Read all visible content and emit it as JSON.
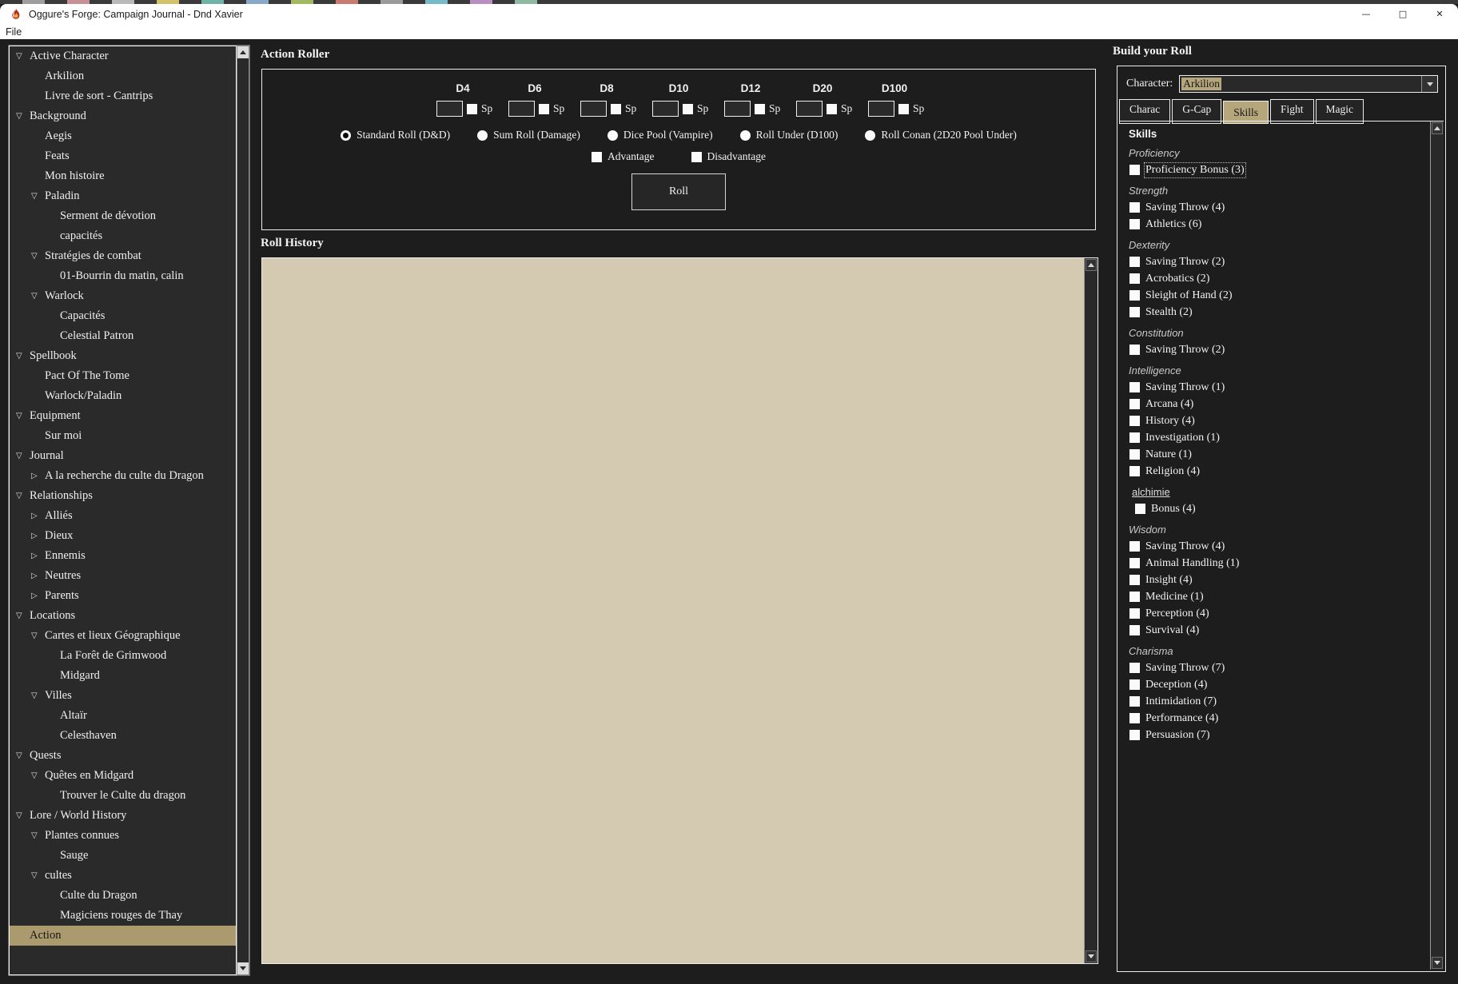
{
  "window": {
    "title": "Oggure's Forge: Campaign Journal - Dnd Xavier",
    "menu": [
      "File"
    ],
    "controls": [
      {
        "name": "minimize",
        "glyph": "—"
      },
      {
        "name": "maximize",
        "glyph": "□"
      },
      {
        "name": "close",
        "glyph": "✕"
      }
    ]
  },
  "background_strip_colors": [
    "#3a3a3c",
    "#9e9e9e",
    "#3a3a3c",
    "#c78f96",
    "#3a3a3c",
    "#b9b9b9",
    "#3a3a3c",
    "#d3c069",
    "#3a3a3c",
    "#6fb3a6",
    "#3a3a3c",
    "#88a7c9",
    "#3a3a3c",
    "#a3b960",
    "#3a3a3c",
    "#c97a70",
    "#3a3a3c",
    "#9b9b9b",
    "#3a3a3c",
    "#76b9c9",
    "#3a3a3c",
    "#b98fc2",
    "#3a3a3c",
    "#8fb9a0",
    "#3a3a3c"
  ],
  "sidebar": {
    "items": [
      {
        "label": "Active Character",
        "level": 0,
        "state": "open"
      },
      {
        "label": "Arkilion",
        "level": 1,
        "state": "leaf"
      },
      {
        "label": "Livre de sort - Cantrips",
        "level": 1,
        "state": "leaf"
      },
      {
        "label": "Background",
        "level": 0,
        "state": "open"
      },
      {
        "label": "Aegis",
        "level": 1,
        "state": "leaf"
      },
      {
        "label": "Feats",
        "level": 1,
        "state": "leaf"
      },
      {
        "label": "Mon histoire",
        "level": 1,
        "state": "leaf"
      },
      {
        "label": "Paladin",
        "level": 1,
        "state": "open"
      },
      {
        "label": "Serment de dévotion",
        "level": 2,
        "state": "leaf"
      },
      {
        "label": "capacités",
        "level": 2,
        "state": "leaf"
      },
      {
        "label": "Stratégies de combat",
        "level": 1,
        "state": "open"
      },
      {
        "label": "01-Bourrin du matin, calin",
        "level": 2,
        "state": "leaf"
      },
      {
        "label": "Warlock",
        "level": 1,
        "state": "open"
      },
      {
        "label": "Capacités",
        "level": 2,
        "state": "leaf"
      },
      {
        "label": "Celestial Patron",
        "level": 2,
        "state": "leaf"
      },
      {
        "label": "Spellbook",
        "level": 0,
        "state": "open"
      },
      {
        "label": "Pact Of The Tome",
        "level": 1,
        "state": "leaf"
      },
      {
        "label": "Warlock/Paladin",
        "level": 1,
        "state": "leaf"
      },
      {
        "label": "Equipment",
        "level": 0,
        "state": "open"
      },
      {
        "label": "Sur moi",
        "level": 1,
        "state": "leaf"
      },
      {
        "label": "Journal",
        "level": 0,
        "state": "open"
      },
      {
        "label": "A la recherche du culte du Dragon",
        "level": 1,
        "state": "closed"
      },
      {
        "label": "Relationships",
        "level": 0,
        "state": "open"
      },
      {
        "label": "Alliés",
        "level": 1,
        "state": "closed"
      },
      {
        "label": "Dieux",
        "level": 1,
        "state": "closed"
      },
      {
        "label": "Ennemis",
        "level": 1,
        "state": "closed"
      },
      {
        "label": "Neutres",
        "level": 1,
        "state": "closed"
      },
      {
        "label": "Parents",
        "level": 1,
        "state": "closed"
      },
      {
        "label": "Locations",
        "level": 0,
        "state": "open"
      },
      {
        "label": "Cartes et lieux Géographique",
        "level": 1,
        "state": "open"
      },
      {
        "label": "La Forêt de Grimwood",
        "level": 2,
        "state": "leaf"
      },
      {
        "label": "Midgard",
        "level": 2,
        "state": "leaf"
      },
      {
        "label": "Villes",
        "level": 1,
        "state": "open"
      },
      {
        "label": "Altaïr",
        "level": 2,
        "state": "leaf"
      },
      {
        "label": "Celesthaven",
        "level": 2,
        "state": "leaf"
      },
      {
        "label": "Quests",
        "level": 0,
        "state": "open"
      },
      {
        "label": "Quêtes en Midgard",
        "level": 1,
        "state": "open"
      },
      {
        "label": "Trouver le Culte du dragon",
        "level": 2,
        "state": "leaf"
      },
      {
        "label": "Lore / World History",
        "level": 0,
        "state": "open"
      },
      {
        "label": "Plantes connues",
        "level": 1,
        "state": "open"
      },
      {
        "label": "Sauge",
        "level": 2,
        "state": "leaf"
      },
      {
        "label": "cultes",
        "level": 1,
        "state": "open"
      },
      {
        "label": "Culte du Dragon",
        "level": 2,
        "state": "leaf"
      },
      {
        "label": "Magiciens rouges de Thay",
        "level": 2,
        "state": "leaf"
      },
      {
        "label": "Action",
        "level": 0,
        "state": "leaf",
        "selected": true
      }
    ]
  },
  "action_roller": {
    "title": "Action Roller",
    "dice": [
      {
        "label": "D4",
        "value": "",
        "sp_label": "Sp",
        "sp_checked": false
      },
      {
        "label": "D6",
        "value": "",
        "sp_label": "Sp",
        "sp_checked": false
      },
      {
        "label": "D8",
        "value": "",
        "sp_label": "Sp",
        "sp_checked": false
      },
      {
        "label": "D10",
        "value": "",
        "sp_label": "Sp",
        "sp_checked": false
      },
      {
        "label": "D12",
        "value": "",
        "sp_label": "Sp",
        "sp_checked": false
      },
      {
        "label": "D20",
        "value": "",
        "sp_label": "Sp",
        "sp_checked": false
      },
      {
        "label": "D100",
        "value": "",
        "sp_label": "Sp",
        "sp_checked": false
      }
    ],
    "roll_modes": [
      {
        "label": "Standard Roll (D&D)",
        "selected": true
      },
      {
        "label": "Sum Roll (Damage)",
        "selected": false
      },
      {
        "label": "Dice Pool (Vampire)",
        "selected": false
      },
      {
        "label": "Roll Under (D100)",
        "selected": false
      },
      {
        "label": "Roll Conan (2D20 Pool Under)",
        "selected": false
      }
    ],
    "modifiers": [
      {
        "label": "Advantage",
        "checked": false
      },
      {
        "label": "Disadvantage",
        "checked": false
      }
    ],
    "roll_button": "Roll"
  },
  "roll_history": {
    "title": "Roll History"
  },
  "build_roll": {
    "title": "Build your Roll",
    "character_label": "Character:",
    "character_value": "Arkilion",
    "tabs": [
      {
        "label": "Charac",
        "active": false
      },
      {
        "label": "G-Cap",
        "active": false
      },
      {
        "label": "Skills",
        "active": true
      },
      {
        "label": "Fight",
        "active": false
      },
      {
        "label": "Magic",
        "active": false
      }
    ],
    "skills": {
      "header": "Skills",
      "focused_item": "Proficiency Bonus (3)",
      "groups": [
        {
          "name": "Proficiency",
          "style": "italic",
          "items": [
            "Proficiency Bonus (3)"
          ]
        },
        {
          "name": "Strength",
          "style": "italic",
          "items": [
            "Saving Throw (4)",
            "Athletics (6)"
          ]
        },
        {
          "name": "Dexterity",
          "style": "italic",
          "items": [
            "Saving Throw (2)",
            "Acrobatics (2)",
            "Sleight of Hand (2)",
            "Stealth (2)"
          ]
        },
        {
          "name": "Constitution",
          "style": "italic",
          "items": [
            "Saving Throw (2)"
          ]
        },
        {
          "name": "Intelligence",
          "style": "italic",
          "items": [
            "Saving Throw (1)",
            "Arcana (4)",
            "History (4)",
            "Investigation (1)",
            "Nature (1)",
            "Religion (4)"
          ]
        },
        {
          "name": "alchimie",
          "style": "underline",
          "items": [
            "Bonus (4)"
          ]
        },
        {
          "name": "Wisdom",
          "style": "italic",
          "items": [
            "Saving Throw (4)",
            "Animal Handling (1)",
            "Insight (4)",
            "Medicine (1)",
            "Perception (4)",
            "Survival (4)"
          ]
        },
        {
          "name": "Charisma",
          "style": "italic",
          "items": [
            "Saving Throw (7)",
            "Deception (4)",
            "Intimidation (7)",
            "Performance (4)",
            "Persuasion (7)"
          ]
        }
      ]
    }
  },
  "colors": {
    "accent_tan": "#b5a67c",
    "selection_tan": "#ab9a6e",
    "history_background": "#d4c9b1",
    "panel_background": "#2a2a2b",
    "window_background": "#1d1d1e",
    "titlebar_background": "#ffffff"
  }
}
